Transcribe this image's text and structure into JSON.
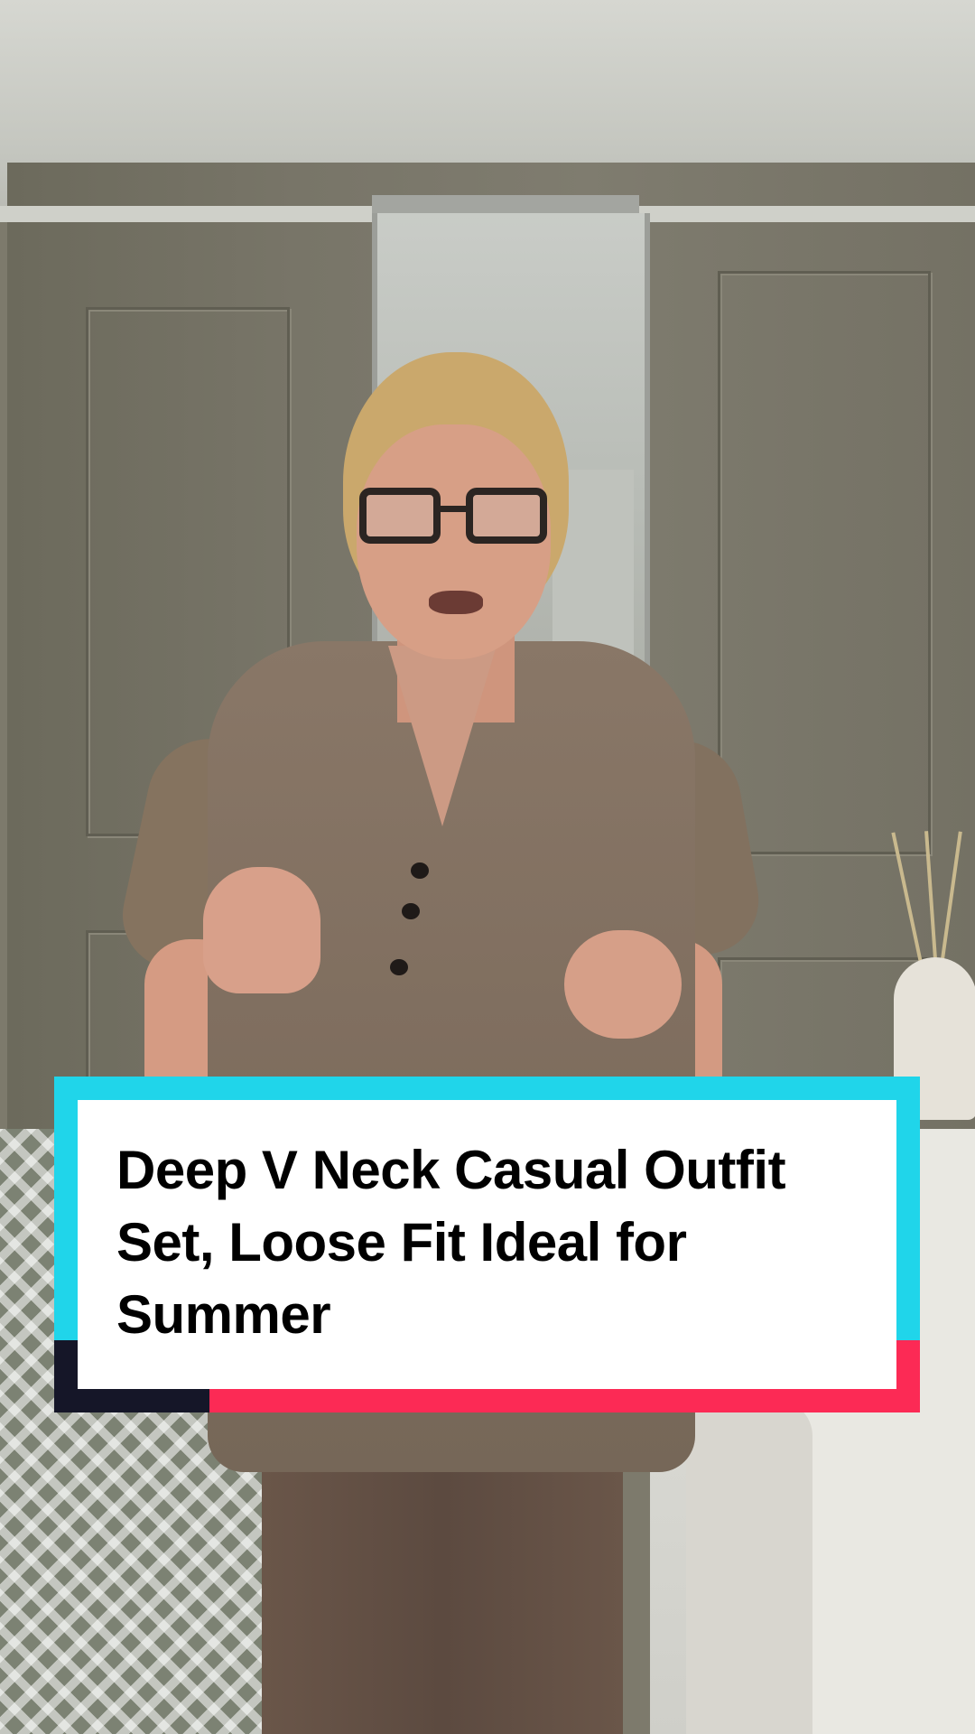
{
  "overlay": {
    "caption_lines": [
      "Deep V Neck Casual Outfit",
      "Set, Loose Fit Ideal for",
      "Summer"
    ]
  },
  "colors": {
    "caption_frame_cyan": "#20d5ea",
    "caption_frame_pink": "#fc2a55",
    "caption_frame_dark": "#151628",
    "caption_card": "#ffffff",
    "caption_text": "#000000"
  }
}
